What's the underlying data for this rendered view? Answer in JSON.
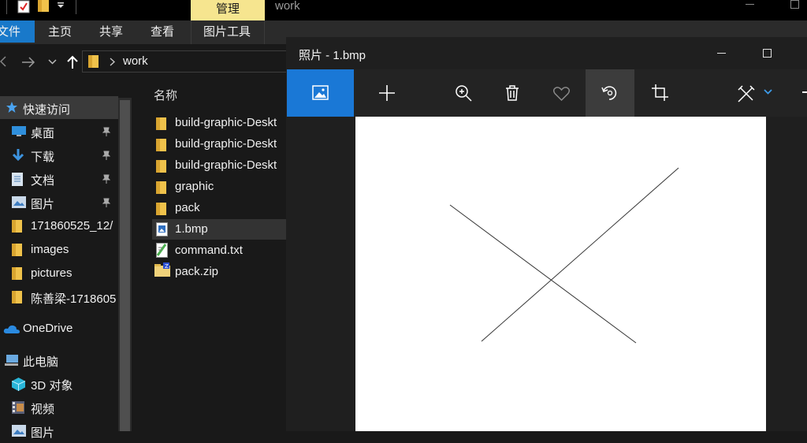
{
  "explorer": {
    "title_tab": "管理",
    "folder_title": "work",
    "ribbon_tabs": [
      "文件",
      "主页",
      "共享",
      "查看",
      "图片工具"
    ],
    "address": "work",
    "column_header": "名称",
    "nav_items": [
      {
        "label": "快速访问",
        "icon": "star-icon"
      },
      {
        "label": "桌面",
        "icon": "desktop-icon",
        "pinned": true
      },
      {
        "label": "下载",
        "icon": "download-icon",
        "pinned": true
      },
      {
        "label": "文档",
        "icon": "document-icon",
        "pinned": true
      },
      {
        "label": "图片",
        "icon": "picture-icon",
        "pinned": true
      },
      {
        "label": "171860525_12/",
        "icon": "folder-icon"
      },
      {
        "label": "images",
        "icon": "folder-icon"
      },
      {
        "label": "pictures",
        "icon": "folder-icon"
      },
      {
        "label": "陈善梁-1718605",
        "icon": "folder-icon"
      },
      {
        "label": "OneDrive",
        "icon": "cloud-icon"
      },
      {
        "label": "此电脑",
        "icon": "computer-icon"
      },
      {
        "label": "3D 对象",
        "icon": "cube-icon"
      },
      {
        "label": "视频",
        "icon": "video-icon"
      },
      {
        "label": "图片",
        "icon": "picture-icon"
      }
    ],
    "files": [
      {
        "name": "build-graphic-Deskt",
        "icon": "folder-icon"
      },
      {
        "name": "build-graphic-Deskt",
        "icon": "folder-icon"
      },
      {
        "name": "build-graphic-Deskt",
        "icon": "folder-icon"
      },
      {
        "name": "graphic",
        "icon": "folder-icon"
      },
      {
        "name": "pack",
        "icon": "folder-icon"
      },
      {
        "name": "1.bmp",
        "icon": "bmp-file-icon",
        "selected": true
      },
      {
        "name": "command.txt",
        "icon": "text-file-icon"
      },
      {
        "name": "pack.zip",
        "icon": "zip-file-icon"
      }
    ]
  },
  "photos": {
    "title": "照片 - 1.bmp",
    "toolbar": [
      "image-icon",
      "add-icon",
      "zoom-in-icon",
      "delete-icon",
      "heart-icon",
      "rotate-icon",
      "crop-icon",
      "edit-icon",
      "chevron-down-icon"
    ]
  },
  "colors": {
    "accent": "#1a78d6",
    "manage_tab": "#f6e58f",
    "background": "#191919"
  }
}
